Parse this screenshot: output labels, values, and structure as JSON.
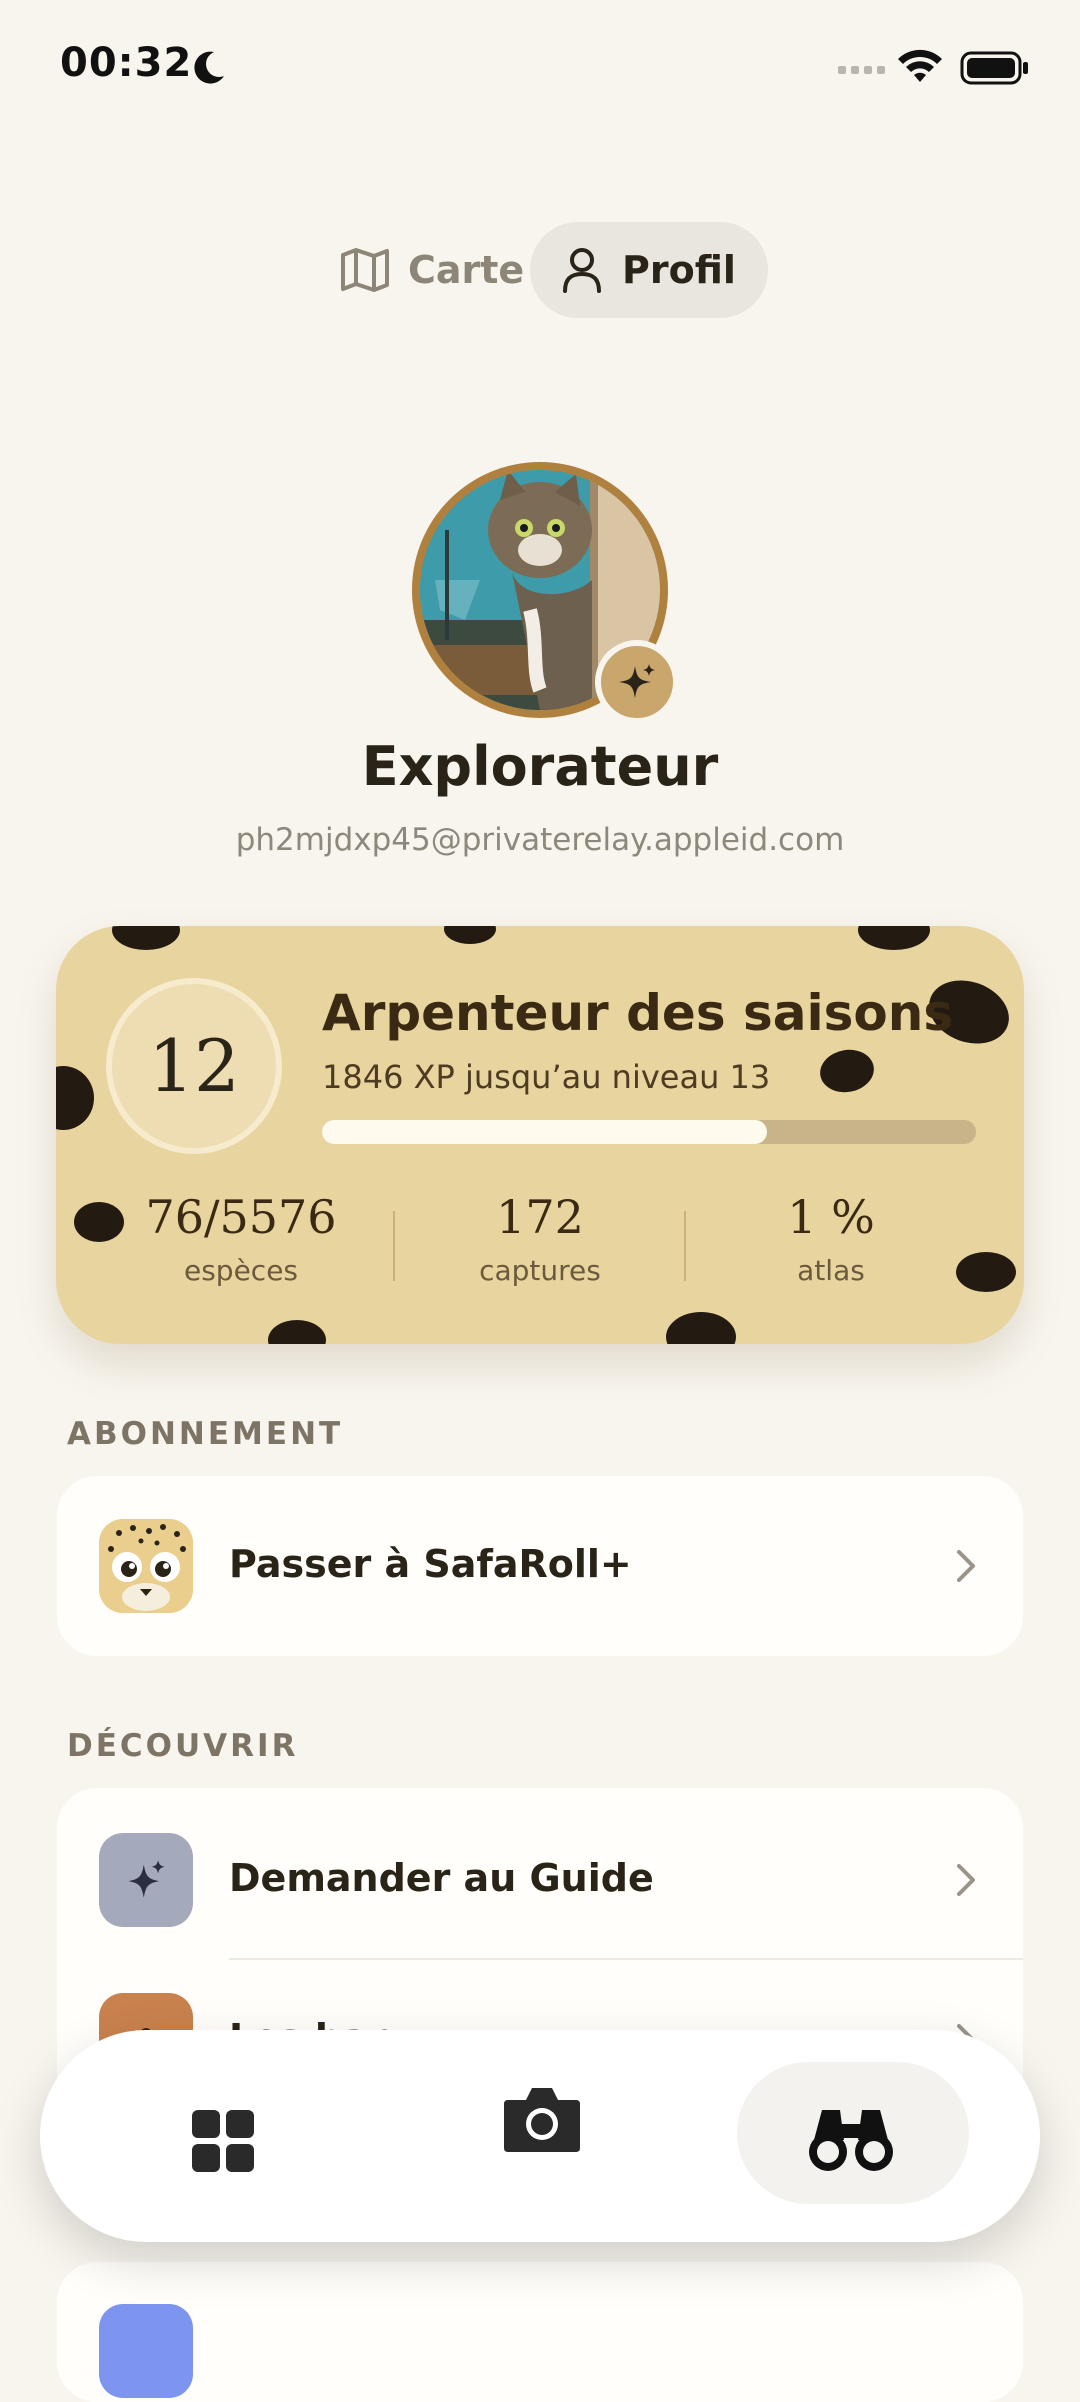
{
  "status_bar": {
    "time": "00:32"
  },
  "toggle": {
    "carte_label": "Carte",
    "profil_label": "Profil",
    "selected": "Profil"
  },
  "profile": {
    "name": "Explorateur",
    "email": "ph2mjdxp45@privaterelay.appleid.com"
  },
  "level_card": {
    "level": "12",
    "title": "Arpenteur des saisons",
    "xp_text": "1846 XP jusqu’au niveau 13",
    "progress": 0.68,
    "stats": [
      {
        "value": "76/5576",
        "label": "espèces"
      },
      {
        "value": "172",
        "label": "captures"
      },
      {
        "value": "1 %",
        "label": "atlas"
      }
    ],
    "colors": {
      "background": "#E8D49E",
      "spots": "#231B12",
      "progress_fill": "#FFFAEE"
    }
  },
  "sections": {
    "abonnement": {
      "header": "ABONNEMENT",
      "items": [
        {
          "label": "Passer à SafaRoll+",
          "icon": "cheetah-mascot-icon"
        }
      ]
    },
    "decouvrir": {
      "header": "DÉCOUVRIR",
      "items": [
        {
          "label": "Demander au Guide",
          "icon": "sparkle-icon",
          "icon_bg": "#A4A9BC"
        },
        {
          "label": "Les ban...",
          "icon": "group-icon",
          "icon_bg": "#C9824E"
        }
      ]
    }
  },
  "tabbar": {
    "items": [
      {
        "name": "dashboard",
        "icon": "grid-icon"
      },
      {
        "name": "camera",
        "icon": "camera-icon"
      },
      {
        "name": "explore",
        "icon": "binoculars-icon",
        "active": true
      }
    ]
  }
}
